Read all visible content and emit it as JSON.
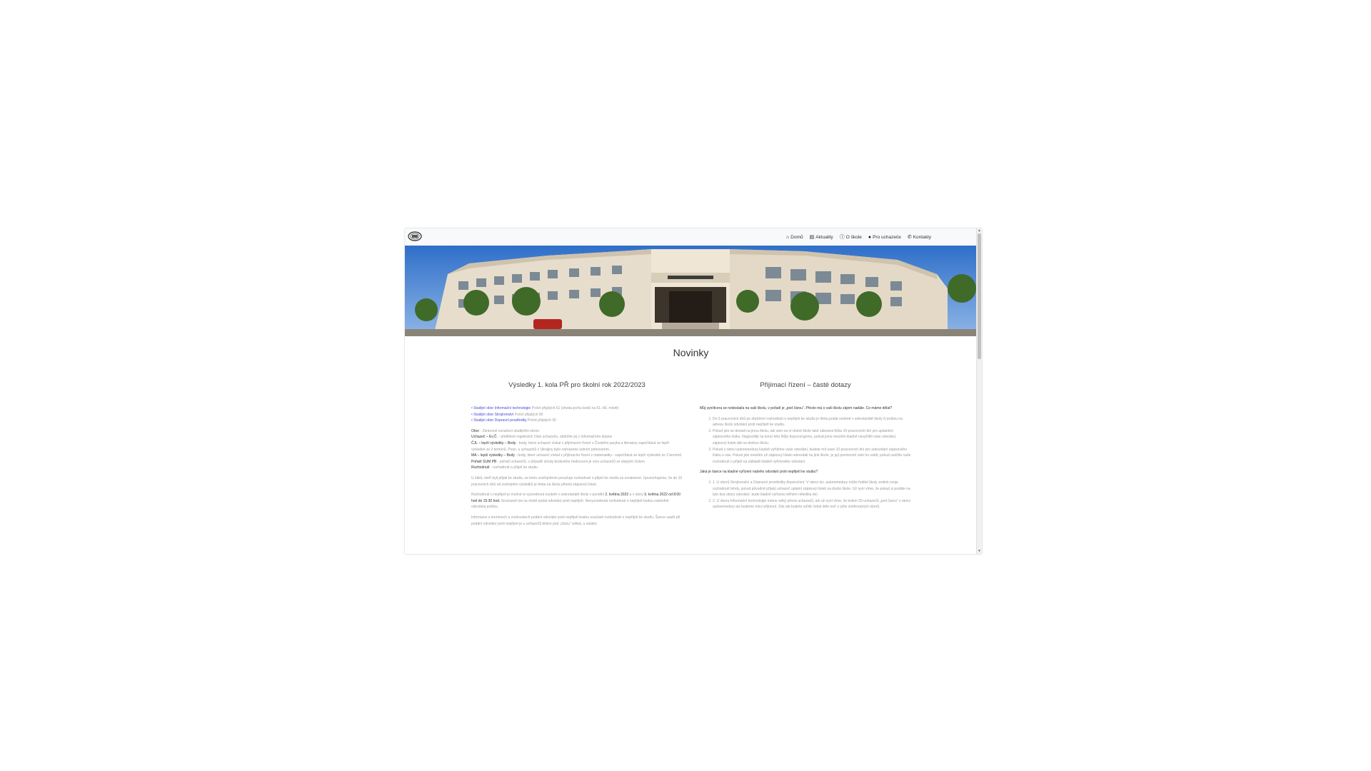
{
  "nav": {
    "items": [
      {
        "label": "Domů",
        "icon": "home-icon",
        "glyph": "⌂"
      },
      {
        "label": "Aktuality",
        "icon": "newspaper-icon",
        "glyph": "▤"
      },
      {
        "label": "O škole",
        "icon": "info-circle-icon",
        "glyph": "ⓘ"
      },
      {
        "label": "Pro uchazeče",
        "icon": "user-icon",
        "glyph": "●"
      },
      {
        "label": "Kontakty",
        "icon": "phone-icon",
        "glyph": "✆"
      }
    ]
  },
  "main": {
    "heading": "Novinky"
  },
  "left": {
    "title": "Výsledky 1. kola PŘ pro školní rok 2022/2023",
    "links": [
      {
        "label": "• Studijní obor Informační technologie",
        "note": "Počet přijatých 61 (shoda počtu bodů na 61.-66. místě)"
      },
      {
        "label": "• Studijní obor Strojírenství",
        "note": "Počet přijatých 60"
      },
      {
        "label": "• Studijní obor Dopravní prostředky",
        "note": "Počet přijatých 30"
      }
    ],
    "legend": [
      {
        "term": "Obor",
        "desc": "- Zkrácené označení studijního oboru"
      },
      {
        "term": "Uchazeč – Ev.Č.",
        "desc": "- přidělené registrační číslo uchazeče, obdržíte jej v informačním dopise"
      },
      {
        "term": "ČJL – lepší výsledky – Body",
        "desc": "- body, které uchazeč získal v přijímacím řízení z Českého jazyka a literatury započítává se lepší výsledek ze 2 termínů. Pozn. u uchazečů z Ukrajiny bylo nahrazeno ústním pohovorem."
      },
      {
        "term": "MA – lepší výsledky – Body",
        "desc": "- body, které uchazeč získal v přijímacím řízení z matematiky - započítává se lepší výsledek ze 2 termínů"
      },
      {
        "term": "Pořadí SUM PB",
        "desc": "- pořadí uchazečů, v případě shody bodového hodnocení je více uchazečů se stejným číslem"
      },
      {
        "term": "Rozhodnutí",
        "desc": "- rozhodnutí o přijetí ke studiu"
      }
    ],
    "para1": "U žáků, kteří byli přijati ke studiu, se tímto zveřejněním považuje rozhodnutí o přijetí ke studiu za oznámené. Upozorňujeme, že do 10 pracovních dnů od zveřejnění výsledků je třeba na školu přinést zápisový lístek.",
    "para2_a": "Rozhodnutí o nepřijetí je možné si vyzvednout osobně v sekretariátě školy v pondělí ",
    "para2_b": "2. května 2022",
    "para2_c": " a v úterý ",
    "para2_d": "3. května 2022 od 8:00 hod do 15:30 hod.",
    "para2_e": " Současně lze na místě podat odvolání proti nepřijetí. Nevyzvednutá rozhodnutí o nepřijetí budou následně odeslána poštou.",
    "para3": "Informace o termínech a možnostech podání odvolání proti nepřijetí budou součástí rozhodnutí o nepřijetí ke studiu. Šance uspět při podání odvolání proti nepřijetí je u uchazečů blízko pod „čárou“ veliká, u ostatní."
  },
  "right": {
    "title": "Přijímací řízení – časté dotazy",
    "q1": "Můj syn/dcera se nedostal/a na vaši školu, v pořadí je „pod čárou“. Přesto má o vaši školu zájem nadále. Co máme dělat?",
    "list1": [
      "Do 3 pracovních dnů po obdržení rozhodnutí o nepřijetí ke studiu je třeba podat osobně v sekretariátě školy či poštou na adresu školy odvolání proti nepřijetí ke studiu.",
      "Pokud jste se dostali na jinou školu, tak vám na ní druhé škole také zákonná lhůta 10 pracovních dní pro uplatnění zápisového lístku. Nejpozději na konci této lhůty doporučujeme, pokud jsme mezitím kladně nevyřídili vaše odvolání, zápisový lístek dát na druhou školu.",
      "Pokud v rámci autoremedury kladně vyřídíme vaše odvolání, budete mít zase 10 pracovních dní pro odevzdání zápisového lístku u nás. Pokud jste mezitím už zápisový lístek odevzdali na jiné škole, je její povinností vám ho vrátit, pokud uvážíte naše rozhodnutí o přijetí na základě kladně vyřízeného odvolání."
    ],
    "q2": "Jaká je šance na kladné vyřízení našeho odvolání proti nepřijetí ke studiu?",
    "list2": [
      "1. U oborů Strojírenství a Dopravní prostředky doporučení: V rámci tzv. autoremedury může ředitel školy změnit svoje rozhodnutí tehdy, pokud původně přijatý uchazeč uplatní zápisový lístek na druhé škole. Už nyní víme, že pokud si podáte na tyto dva obory odvolání, bude kladně vyřízeno během několika dní.",
      "2. U oboru Informační technologie máme velký převis uchazečů, ale už nyní víme, že kolem 20 uchazečů „pod čarou“ v rámci autoremedury asi budeme moci přijmout. Zde ale budete určitě čekat déle než u výše zmiňovaných oborů."
    ]
  }
}
